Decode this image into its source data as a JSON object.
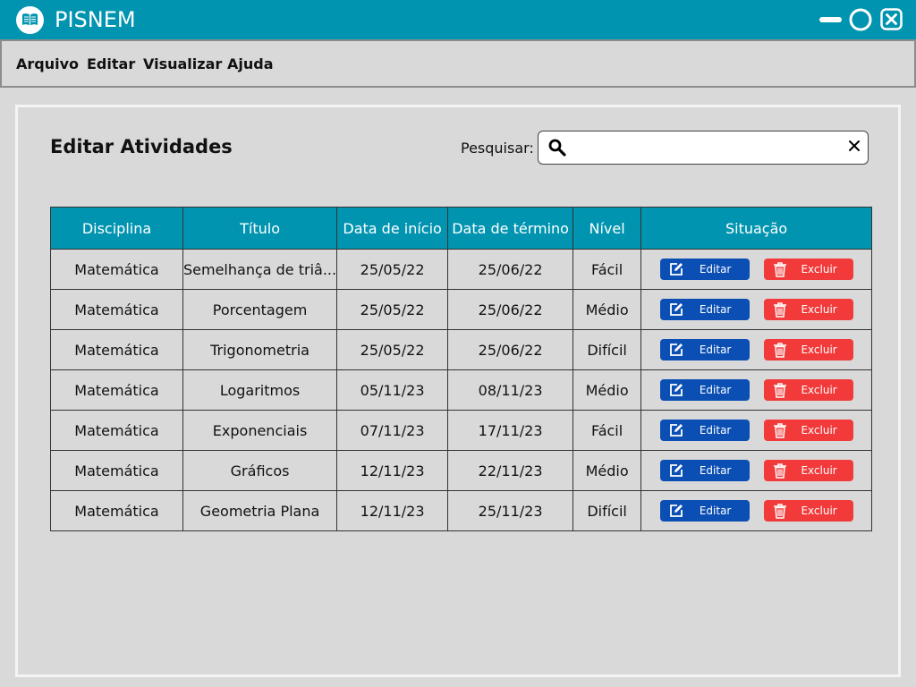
{
  "app": {
    "title": "PISNEM"
  },
  "menu": {
    "items": [
      "Arquivo",
      "Editar",
      "Visualizar",
      "Ajuda"
    ]
  },
  "page": {
    "title": "Editar Atividades"
  },
  "search": {
    "label": "Pesquisar:",
    "value": "",
    "placeholder": ""
  },
  "table": {
    "headers": [
      "Disciplina",
      "Título",
      "Data de início",
      "Data de término",
      "Nível",
      "Situação"
    ],
    "edit_label": "Editar",
    "delete_label": "Excluir",
    "rows": [
      [
        "Matemática",
        "Semelhança de triâ...",
        "25/05/22",
        "25/06/22",
        "Fácil"
      ],
      [
        "Matemática",
        "Porcentagem",
        "25/05/22",
        "25/06/22",
        "Médio"
      ],
      [
        "Matemática",
        "Trigonometria",
        "25/05/22",
        "25/06/22",
        "Difícil"
      ],
      [
        "Matemática",
        "Logaritmos",
        "05/11/23",
        "08/11/23",
        "Médio"
      ],
      [
        "Matemática",
        "Exponenciais",
        "07/11/23",
        "17/11/23",
        "Fácil"
      ],
      [
        "Matemática",
        "Gráficos",
        "12/11/23",
        "22/11/23",
        "Médio"
      ],
      [
        "Matemática",
        "Geometria Plana",
        "12/11/23",
        "25/11/23",
        "Difícil"
      ]
    ]
  },
  "colors": {
    "accent": "#0094b0",
    "edit": "#0b4fb4",
    "delete": "#f23a3a",
    "background": "#d9d9d9"
  },
  "icons": {
    "logo": "open-book-icon",
    "minimize": "minimize-icon",
    "maximize": "maximize-icon",
    "close": "close-icon",
    "search": "search-icon",
    "clear": "clear-icon",
    "edit": "edit-icon",
    "delete": "trash-icon"
  }
}
